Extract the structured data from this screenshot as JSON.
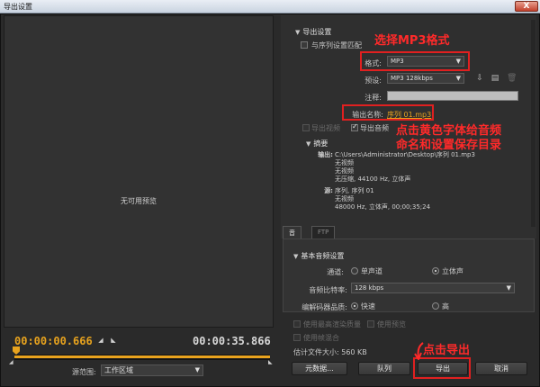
{
  "window": {
    "title": "导出设置",
    "close_label": "X"
  },
  "preview": {
    "no_preview": "无可用预览",
    "timecode_start": "00:00:00.666",
    "timecode_end": "00:00:35.866",
    "source_range_label": "源范围:",
    "source_range_value": "工作区域"
  },
  "export_settings": {
    "header": "导出设置",
    "match_sequence": "与序列设置匹配",
    "format_label": "格式:",
    "format_value": "MP3",
    "preset_label": "预设:",
    "preset_value": "MP3 128kbps",
    "comment_label": "注释:",
    "output_name_label": "输出名称:",
    "output_name_value": "序列 01.mp3",
    "export_video": "导出视频",
    "export_audio": "导出音频",
    "summary_header": "摘要",
    "output_key": "输出:",
    "output_lines": [
      "C:\\Users\\Administrator\\Desktop\\序列 01.mp3",
      "无视频",
      "无视频",
      "无压缩, 44100 Hz, 立体声"
    ],
    "source_key": "源:",
    "source_lines": [
      "序列, 序列 01",
      "无视频",
      "48000 Hz, 立体声, 00;00;35;24"
    ]
  },
  "tabs": [
    {
      "label": "音频"
    },
    {
      "label": "FTP"
    }
  ],
  "audio": {
    "header": "基本音频设置",
    "channels_label": "通道:",
    "mono": "单声道",
    "stereo": "立体声",
    "bitrate_label": "音频比特率:",
    "bitrate_value": "128 kbps",
    "quality_label": "编解码器品质:",
    "fast": "快速",
    "high": "高"
  },
  "options": {
    "max_render": "使用最高渲染质量",
    "use_preview": "使用预览",
    "frame_blend": "使用帧混合",
    "file_size": "估计文件大小: 560 KB"
  },
  "buttons": {
    "metadata": "元数据...",
    "queue": "队列",
    "export": "导出",
    "cancel": "取消"
  },
  "annotations": {
    "choose_format": "选择MP3格式",
    "click_name_1": "点击黄色字体给音频",
    "click_name_2": "命名和设置保存目录",
    "click_export": "点击导出"
  },
  "colors": {
    "accent": "#e8a31e",
    "annotation": "#e02020"
  }
}
